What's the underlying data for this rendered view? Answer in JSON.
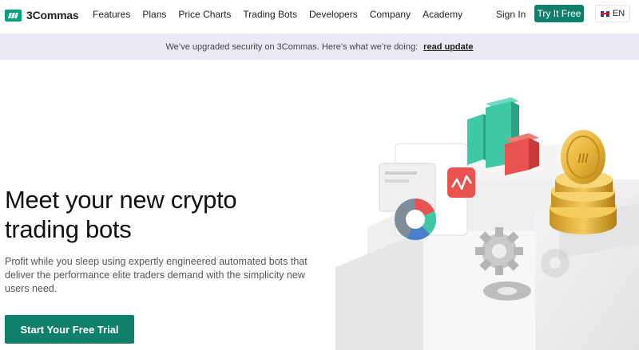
{
  "brand": {
    "name": "3Commas",
    "accent": "#11806a",
    "logo_color": "#00a37a"
  },
  "nav": {
    "links": [
      "Features",
      "Plans",
      "Price Charts",
      "Trading Bots",
      "Developers",
      "Company",
      "Academy"
    ],
    "sign_in": "Sign In",
    "try_free": "Try It Free",
    "language": "EN"
  },
  "banner": {
    "text": "We’ve upgraded security on 3Commas. Here’s what we’re doing:",
    "link": "read update",
    "background": "#e9eaf5"
  },
  "hero": {
    "title": "Meet your new crypto trading bots",
    "subtitle": "Profit while you sleep using expertly engineered automated bots that deliver the performance elite traders demand with the simplicity new users need.",
    "cta": "Start Your Free Trial"
  },
  "illustration": {
    "icons": [
      "bar-chart-icon",
      "pie-chart-icon",
      "line-chart-icon",
      "coin-stack-icon",
      "gear-icon"
    ],
    "colors": {
      "teal": "#3ec8a6",
      "red": "#e8524f",
      "gold": "#e9b53a"
    }
  }
}
